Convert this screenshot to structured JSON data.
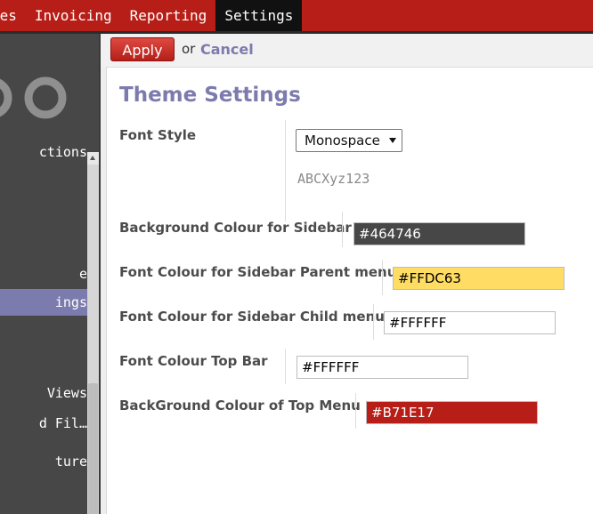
{
  "topbar": {
    "menu": [
      "les",
      "Invoicing",
      "Reporting",
      "Settings"
    ],
    "active": "Settings"
  },
  "sidebar": {
    "items": [
      {
        "label": "ctions"
      },
      {
        "label": "e"
      },
      {
        "label": "ings"
      },
      {
        "label": "Views"
      },
      {
        "label": "d Fil…"
      },
      {
        "label": "ture"
      }
    ],
    "active_index": 2
  },
  "actions": {
    "apply_label": "Apply",
    "or_text": "or",
    "cancel_label": "Cancel"
  },
  "form": {
    "title": "Theme Settings",
    "font_style": {
      "label": "Font Style",
      "value": "Monospace",
      "preview": "ABCXyz123"
    },
    "bg_sidebar": {
      "label": "Background Colour for Sidebar",
      "value": "#464746",
      "bg": "#464746",
      "fg": "#ffffff"
    },
    "font_sidebar_parent": {
      "label": "Font Colour for Sidebar Parent menu",
      "value": "#FFDC63",
      "bg": "#ffdc63",
      "fg": "#000000"
    },
    "font_sidebar_child": {
      "label": "Font Colour for Sidebar Child menu",
      "value": "#FFFFFF",
      "bg": "#ffffff",
      "fg": "#000000"
    },
    "font_topbar": {
      "label": "Font Colour Top Bar",
      "value": "#FFFFFF",
      "bg": "#ffffff",
      "fg": "#000000"
    },
    "bg_topmenu": {
      "label": "BackGround Colour of Top Menu",
      "value": "#B71E17",
      "bg": "#b71e17",
      "fg": "#ffffff"
    }
  },
  "colors": {
    "accent": "#7c7bad",
    "topbar": "#b71e17"
  }
}
